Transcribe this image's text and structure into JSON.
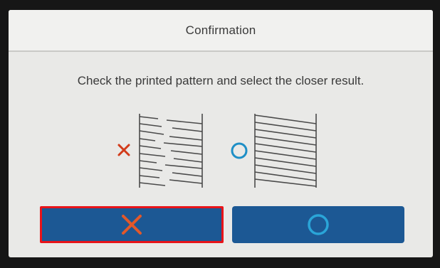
{
  "dialog": {
    "title": "Confirmation",
    "instruction": "Check the printed pattern and select the closer result."
  },
  "patterns": {
    "bad": {
      "marker_icon": "x-mark-icon",
      "marker_color": "#d23b1a",
      "description_icon": "misaligned-lines-pattern-icon"
    },
    "good": {
      "marker_icon": "circle-mark-icon",
      "marker_color": "#1e8fc6",
      "description_icon": "aligned-lines-pattern-icon"
    }
  },
  "buttons": {
    "ng": {
      "icon": "x-mark-icon",
      "icon_color": "#e2582a",
      "highlight_color": "#e8141a"
    },
    "ok": {
      "icon": "circle-mark-icon",
      "icon_color": "#2aa5d8"
    }
  },
  "colors": {
    "button_bg": "#1c5894",
    "screen_bg": "#e9e9e7",
    "text": "#3a3a3a"
  }
}
